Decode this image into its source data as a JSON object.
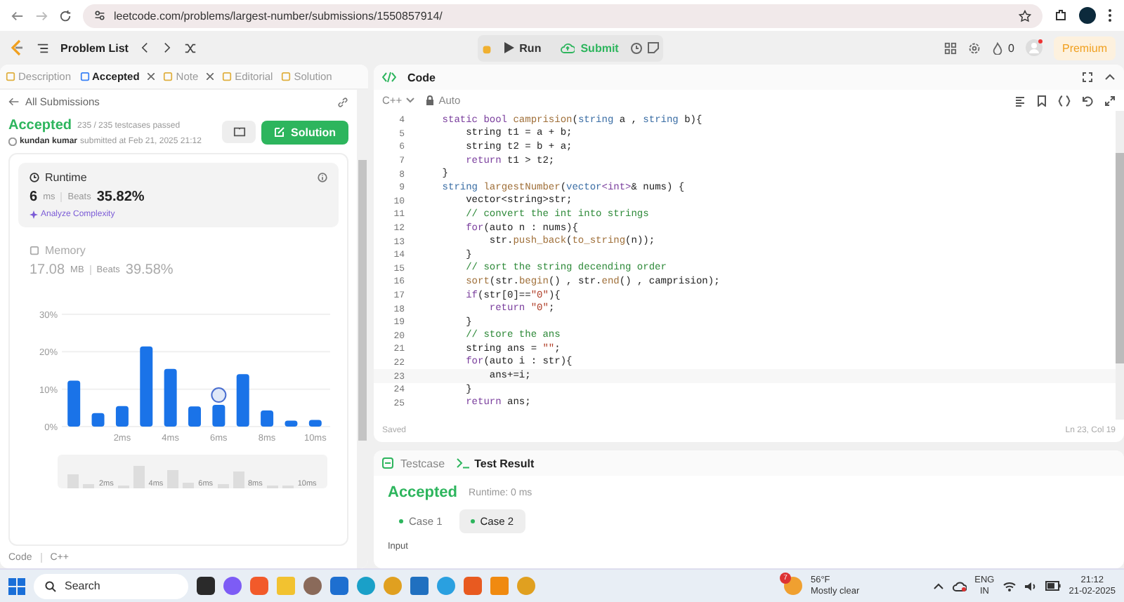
{
  "browser": {
    "url": "leetcode.com/problems/largest-number/submissions/1550857914/"
  },
  "header": {
    "problem_list": "Problem List",
    "run": "Run",
    "submit": "Submit",
    "points": "0",
    "premium": "Premium"
  },
  "left_tabs": [
    {
      "label": "Description",
      "selected": false,
      "closable": false
    },
    {
      "label": "Accepted",
      "selected": true,
      "closable": true
    },
    {
      "label": "Note",
      "selected": false,
      "closable": true
    },
    {
      "label": "Editorial",
      "selected": false,
      "closable": false
    },
    {
      "label": "Solution",
      "selected": false,
      "closable": false
    }
  ],
  "back_link": "All Submissions",
  "submission": {
    "status": "Accepted",
    "passed": "235 / 235 testcases passed",
    "user": "kundan kumar",
    "submitted": "submitted at Feb 21, 2025 21:12",
    "solution_button": "Solution"
  },
  "runtime": {
    "title": "Runtime",
    "value": "6",
    "unit": "ms",
    "beats_label": "Beats",
    "beats": "35.82%",
    "analyze": "Analyze Complexity"
  },
  "memory": {
    "title": "Memory",
    "value": "17.08",
    "unit": "MB",
    "beats_label": "Beats",
    "beats": "39.58%"
  },
  "chart_data": {
    "type": "bar",
    "x": [
      0,
      1,
      2,
      3,
      4,
      5,
      6,
      7,
      8,
      9,
      10
    ],
    "xlim": [
      -0.5,
      10.5
    ],
    "series": [
      {
        "color": "#1a73e8",
        "values": [
          12.3,
          3.6,
          5.5,
          21.4,
          15.4,
          5.4,
          5.8,
          14,
          4.3,
          1.6,
          1.8
        ]
      }
    ],
    "ylim": [
      0,
      30
    ],
    "yticks": [
      {
        "value": 0,
        "label": "0%"
      },
      {
        "value": 10,
        "label": "10%"
      },
      {
        "value": 20,
        "label": "20%"
      },
      {
        "value": 30,
        "label": "30%"
      }
    ],
    "xticks": [
      {
        "value": 2,
        "label": "2ms"
      },
      {
        "value": 4,
        "label": "4ms"
      },
      {
        "value": 6,
        "label": "6ms"
      },
      {
        "value": 8,
        "label": "8ms"
      },
      {
        "value": 10,
        "label": "10ms"
      }
    ]
  },
  "overview_labels": [
    "2ms",
    "4ms",
    "6ms",
    "8ms",
    "10ms"
  ],
  "code_footer": {
    "label": "Code",
    "language": "C++"
  },
  "editor": {
    "title": "Code",
    "language": "C++",
    "mode": "Auto",
    "saved": "Saved",
    "cursor": "Ln 23, Col 19",
    "lines": [
      {
        "no": "4",
        "tokens": [
          {
            "t": "    static bool ",
            "kind": "kw"
          },
          {
            "t": "camprision",
            "kind": "fn"
          },
          {
            "t": "(",
            "kind": "p"
          },
          {
            "t": "string",
            "kind": "type"
          },
          {
            "t": " a , ",
            "kind": "p"
          },
          {
            "t": "string",
            "kind": "type"
          },
          {
            "t": " b){",
            "kind": "p"
          }
        ]
      },
      {
        "no": "5",
        "tokens": [
          {
            "t": "        string t1 = a + b;",
            "kind": "p"
          }
        ]
      },
      {
        "no": "6",
        "tokens": [
          {
            "t": "        string t2 = b + a;",
            "kind": "p"
          }
        ]
      },
      {
        "no": "7",
        "tokens": [
          {
            "t": "        return",
            "kind": "kw"
          },
          {
            "t": " t1 > t2;",
            "kind": "p"
          }
        ]
      },
      {
        "no": "8",
        "tokens": [
          {
            "t": "    }",
            "kind": "p"
          }
        ]
      },
      {
        "no": "9",
        "tokens": [
          {
            "t": "    string ",
            "kind": "type"
          },
          {
            "t": "largestNumber",
            "kind": "fn"
          },
          {
            "t": "(",
            "kind": "p"
          },
          {
            "t": "vector",
            "kind": "type"
          },
          {
            "t": "<int>",
            "kind": "kw"
          },
          {
            "t": "& nums) {",
            "kind": "p"
          }
        ]
      },
      {
        "no": "10",
        "tokens": [
          {
            "t": "        vector<string>str;",
            "kind": "p"
          }
        ]
      },
      {
        "no": "11",
        "tokens": [
          {
            "t": "        // convert the int into strings",
            "kind": "c"
          }
        ]
      },
      {
        "no": "12",
        "tokens": [
          {
            "t": "        for",
            "kind": "kw"
          },
          {
            "t": "(auto n : nums){",
            "kind": "p"
          }
        ]
      },
      {
        "no": "13",
        "tokens": [
          {
            "t": "            str.",
            "kind": "p"
          },
          {
            "t": "push_back",
            "kind": "fn"
          },
          {
            "t": "(",
            "kind": "p"
          },
          {
            "t": "to_string",
            "kind": "fn"
          },
          {
            "t": "(n));",
            "kind": "p"
          }
        ]
      },
      {
        "no": "14",
        "tokens": [
          {
            "t": "        }",
            "kind": "p"
          }
        ]
      },
      {
        "no": "15",
        "tokens": [
          {
            "t": "        // sort the string decending order",
            "kind": "c"
          }
        ]
      },
      {
        "no": "16",
        "tokens": [
          {
            "t": "        sort",
            "kind": "fn"
          },
          {
            "t": "(str.",
            "kind": "p"
          },
          {
            "t": "begin",
            "kind": "fn"
          },
          {
            "t": "() , str.",
            "kind": "p"
          },
          {
            "t": "end",
            "kind": "fn"
          },
          {
            "t": "() , camprision);",
            "kind": "p"
          }
        ]
      },
      {
        "no": "17",
        "tokens": [
          {
            "t": "        if",
            "kind": "kw"
          },
          {
            "t": "(str[0]==",
            "kind": "p"
          },
          {
            "t": "\"0\"",
            "kind": "s"
          },
          {
            "t": "){",
            "kind": "p"
          }
        ]
      },
      {
        "no": "18",
        "tokens": [
          {
            "t": "            return ",
            "kind": "kw"
          },
          {
            "t": "\"0\"",
            "kind": "s"
          },
          {
            "t": ";",
            "kind": "p"
          }
        ]
      },
      {
        "no": "19",
        "tokens": [
          {
            "t": "        }",
            "kind": "p"
          }
        ]
      },
      {
        "no": "20",
        "tokens": [
          {
            "t": "        // store the ans",
            "kind": "c"
          }
        ]
      },
      {
        "no": "21",
        "tokens": [
          {
            "t": "        string ans = ",
            "kind": "p"
          },
          {
            "t": "\"\"",
            "kind": "s"
          },
          {
            "t": ";",
            "kind": "p"
          }
        ]
      },
      {
        "no": "22",
        "tokens": [
          {
            "t": "        for",
            "kind": "kw"
          },
          {
            "t": "(auto i : str){",
            "kind": "p"
          }
        ]
      },
      {
        "no": "23",
        "tokens": [
          {
            "t": "            ans+=i;",
            "kind": "p"
          }
        ]
      },
      {
        "no": "24",
        "tokens": [
          {
            "t": "        }",
            "kind": "p"
          }
        ]
      },
      {
        "no": "25",
        "tokens": [
          {
            "t": "        return",
            "kind": "kw"
          },
          {
            "t": " ans;",
            "kind": "p"
          }
        ]
      }
    ]
  },
  "bottom_tabs": [
    {
      "label": "Testcase",
      "selected": false
    },
    {
      "label": "Test Result",
      "selected": true
    }
  ],
  "result": {
    "status": "Accepted",
    "runtime": "Runtime: 0 ms",
    "input_label": "Input"
  },
  "cases": [
    {
      "label": "Case 1",
      "selected": false
    },
    {
      "label": "Case 2",
      "selected": true
    }
  ],
  "taskbar": {
    "search": "Search",
    "weather_badge": "7",
    "temperature": "56°F",
    "weather": "Mostly clear",
    "lang": "ENG",
    "region": "IN",
    "time": "21:12",
    "date": "21-02-2025"
  }
}
